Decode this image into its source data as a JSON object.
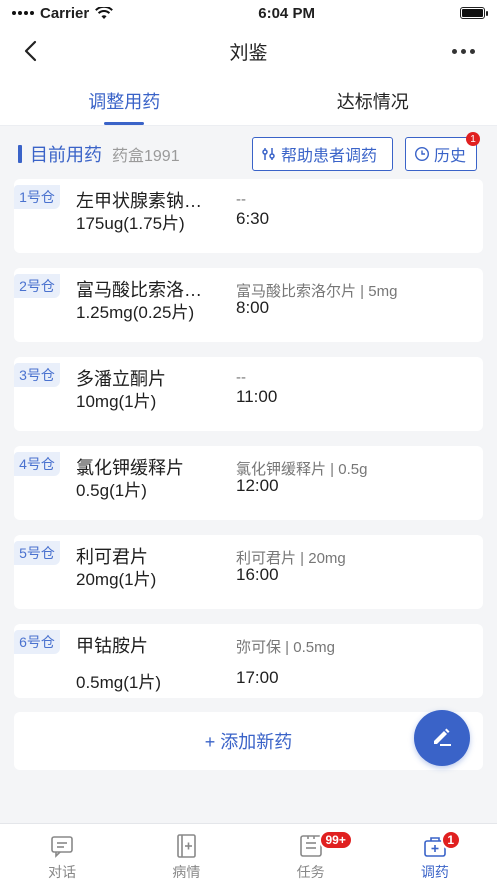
{
  "status_bar": {
    "carrier": "Carrier",
    "time": "6:04 PM"
  },
  "nav": {
    "title": "刘鉴"
  },
  "tabs": [
    {
      "label": "调整用药",
      "active": true
    },
    {
      "label": "达标情况",
      "active": false
    }
  ],
  "section": {
    "title": "目前用药",
    "box_id": "药盒1991",
    "help_button": "帮助患者调药",
    "history_button": "历史",
    "history_badge": "1"
  },
  "medications": [
    {
      "slot": "1号仓",
      "name": "左甲状腺素钠…",
      "dose": "175ug(1.75片)",
      "brand": "--",
      "time": "6:30"
    },
    {
      "slot": "2号仓",
      "name": "富马酸比索洛…",
      "dose": "1.25mg(0.25片)",
      "brand": "富马酸比索洛尔片 | 5mg",
      "time": "8:00"
    },
    {
      "slot": "3号仓",
      "name": "多潘立酮片",
      "dose": "10mg(1片)",
      "brand": "--",
      "time": "11:00"
    },
    {
      "slot": "4号仓",
      "name": "氯化钾缓释片",
      "dose": "0.5g(1片)",
      "brand": "氯化钾缓释片 | 0.5g",
      "time": "12:00"
    },
    {
      "slot": "5号仓",
      "name": "利可君片",
      "dose": "20mg(1片)",
      "brand": "利可君片 | 20mg",
      "time": "16:00"
    },
    {
      "slot": "6号仓",
      "name": "甲钴胺片",
      "dose": "0.5mg(1片)",
      "brand": "弥可保 | 0.5mg",
      "time": "17:00"
    }
  ],
  "add_button": "+ 添加新药",
  "tabbar": [
    {
      "label": "对话",
      "icon": "chat-icon",
      "badge": ""
    },
    {
      "label": "病情",
      "icon": "medical-record-icon",
      "badge": ""
    },
    {
      "label": "任务",
      "icon": "task-icon",
      "badge": "99+"
    },
    {
      "label": "调药",
      "icon": "medicine-box-icon",
      "badge": "1"
    }
  ],
  "colors": {
    "accent": "#3a63c8",
    "badge": "#e02020",
    "slot_tag_bg": "#e9effa"
  }
}
